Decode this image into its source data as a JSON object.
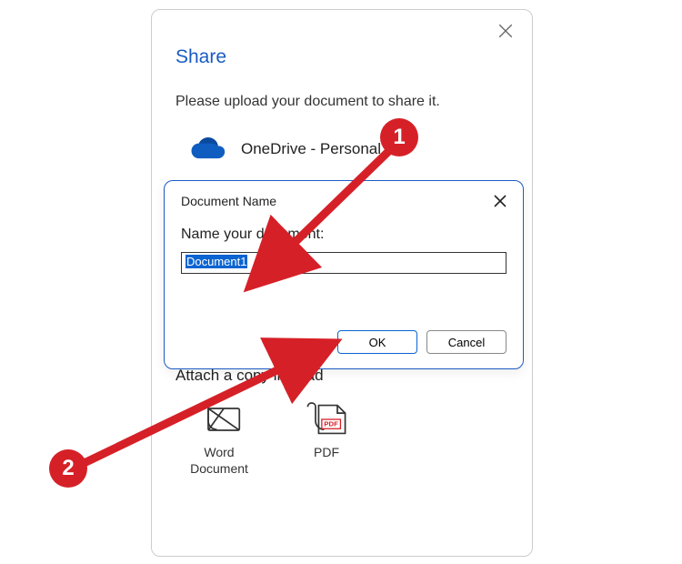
{
  "share": {
    "title": "Share",
    "instruction": "Please upload your document to share it.",
    "onedrive_label": "OneDrive - Personal",
    "attach_copy_label": "Attach a copy instead",
    "attach_options": {
      "word": "Word Document",
      "pdf": "PDF"
    }
  },
  "doc_name": {
    "header": "Document Name",
    "prompt": "Name your document:",
    "value": "Document1",
    "ok": "OK",
    "cancel": "Cancel"
  },
  "annotations": {
    "marker1": "1",
    "marker2": "2"
  }
}
